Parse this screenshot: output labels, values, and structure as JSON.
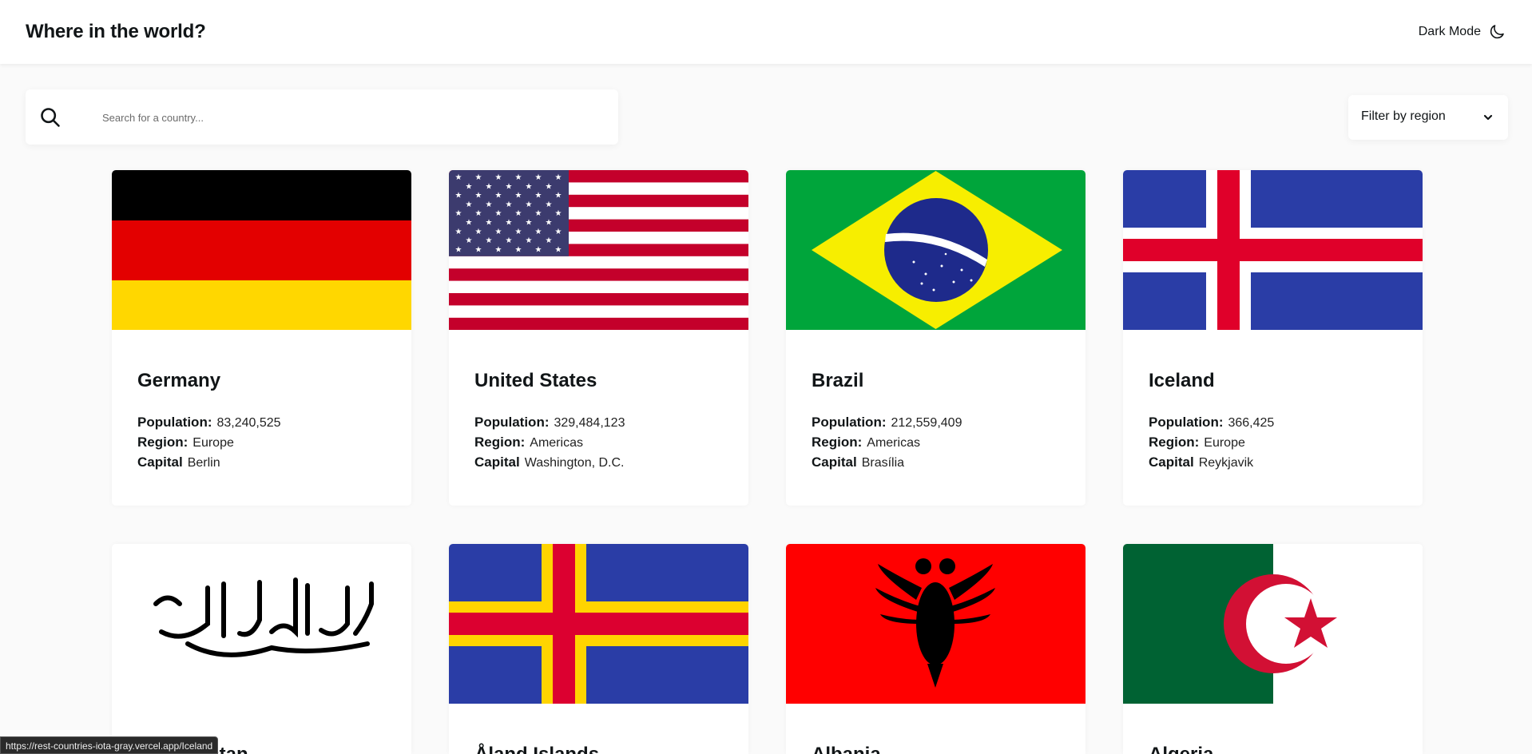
{
  "header": {
    "title": "Where in the world?",
    "dark_mode_label": "Dark Mode"
  },
  "search": {
    "placeholder": "Search for a country...",
    "value": ""
  },
  "filter": {
    "label": "Filter by region"
  },
  "labels": {
    "population": "Population:",
    "region": "Region:",
    "capital": "Capital"
  },
  "countries": [
    {
      "name": "Germany",
      "population": "83,240,525",
      "region": "Europe",
      "capital": "Berlin",
      "flag": "germany-flag"
    },
    {
      "name": "United States",
      "population": "329,484,123",
      "region": "Americas",
      "capital": "Washington, D.C.",
      "flag": "usa-flag"
    },
    {
      "name": "Brazil",
      "population": "212,559,409",
      "region": "Americas",
      "capital": "Brasília",
      "flag": "brazil-flag"
    },
    {
      "name": "Iceland",
      "population": "366,425",
      "region": "Europe",
      "capital": "Reykjavik",
      "flag": "iceland-flag"
    },
    {
      "name": "Afghanistan",
      "flag": "afghanistan-flag"
    },
    {
      "name": "Åland Islands",
      "flag": "aland-flag"
    },
    {
      "name": "Albania",
      "flag": "albania-flag"
    },
    {
      "name": "Algeria",
      "flag": "algeria-flag"
    }
  ],
  "status_bar": {
    "url": "https://rest-countries-iota-gray.vercel.app/Iceland"
  },
  "colors": {
    "background": "#fafafa",
    "card": "#ffffff",
    "text": "#111517"
  }
}
